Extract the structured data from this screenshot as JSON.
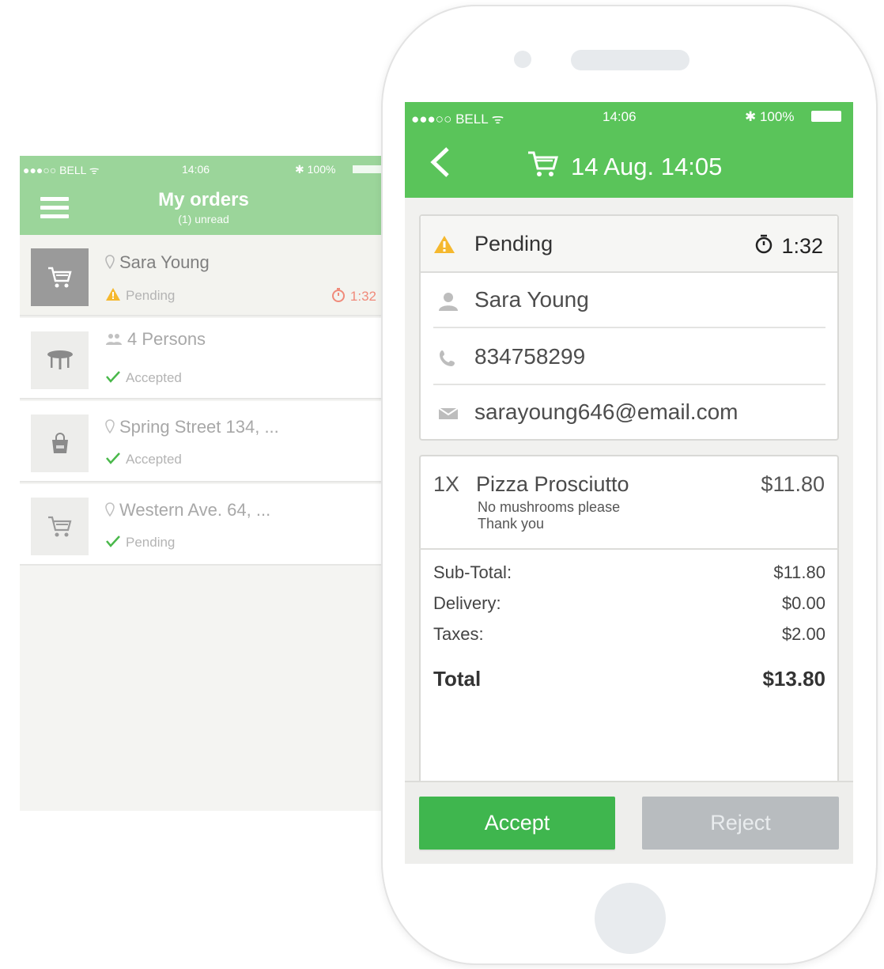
{
  "list_screen": {
    "status": {
      "carrier": "●●●○○ BELL ᯤ",
      "time": "14:06",
      "battery": "✱ 100%"
    },
    "header": {
      "title": "My orders",
      "subtitle": "(1) unread"
    },
    "orders": [
      {
        "type": "cart-icon",
        "line1": "Sara Young",
        "line1_icon": "pin-icon",
        "status": "Pending",
        "status_icon": "warning-icon",
        "timer": "1:32"
      },
      {
        "type": "table-icon",
        "line1": "4 Persons",
        "line1_icon": "people-icon",
        "status": "Accepted",
        "status_icon": "check-icon"
      },
      {
        "type": "bag-icon",
        "line1": "Spring Street 134, ...",
        "line1_icon": "pin-icon",
        "status": "Accepted",
        "status_icon": "check-icon"
      },
      {
        "type": "cart-icon",
        "line1": "Western Ave. 64, ...",
        "line1_icon": "pin-icon",
        "status": "Pending",
        "status_icon": "check-icon"
      }
    ]
  },
  "detail_screen": {
    "status": {
      "carrier": "●●●○○ BELL ᯤ",
      "time": "14:06",
      "battery": "✱ 100%"
    },
    "header": {
      "title": "14 Aug. 14:05"
    },
    "order_status": {
      "label": "Pending",
      "timer": "1:32"
    },
    "contact": {
      "name": "Sara Young",
      "phone": "834758299",
      "email": "sarayoung646@email.com"
    },
    "item": {
      "qty": "1X",
      "name": "Pizza Prosciutto",
      "note_line1": "No mushrooms please",
      "note_line2": "Thank you",
      "price": "$11.80"
    },
    "totals": {
      "subtotal_label": "Sub-Total:",
      "subtotal": "$11.80",
      "delivery_label": "Delivery:",
      "delivery": "$0.00",
      "taxes_label": "Taxes:",
      "taxes": "$2.00",
      "total_label": "Total",
      "total": "$13.80"
    },
    "actions": {
      "accept": "Accept",
      "reject": "Reject"
    }
  },
  "colors": {
    "brand_green": "#5ac45a",
    "accept_green": "#3fb64e",
    "reject_gray": "#b8bcbf",
    "warning_yellow": "#f5b82e",
    "timer_red": "#f08a7a"
  }
}
